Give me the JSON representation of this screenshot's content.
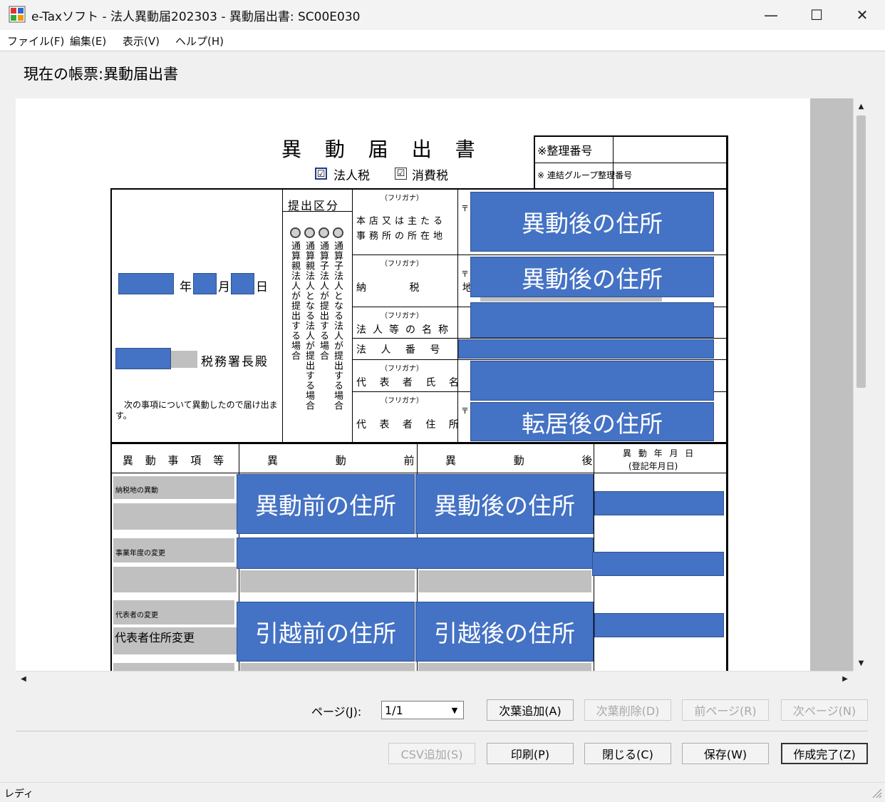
{
  "window": {
    "title": "e-Taxソフト - 法人異動届202303 - 異動届出書: SC00E030"
  },
  "window_buttons": {
    "minimize": "—",
    "maximize": "☐",
    "close": "✕"
  },
  "menu": [
    "ファイル(F)",
    "編集(E)",
    "表示(V)",
    "ヘルプ(H)"
  ],
  "current_form": "現在の帳票:異動届出書",
  "form": {
    "title": "異 動 届 出 書",
    "tax_types": [
      "法人税",
      "消費税"
    ],
    "tax_check_mark": "☑",
    "ref_number_label": "※整理番号",
    "group_ref_label": "※ 連結グループ整理番号",
    "date_labels": [
      "年",
      "月",
      "日"
    ],
    "tax_office_suffix": "税務署長殿",
    "notice": "次の事項について異動したので届け出ます。",
    "submit_category": "提出区分",
    "submit_options": [
      "通算子法人となる法人が提出する場合",
      "通算子法人が提出する場合",
      "通算親法人となる法人が提出する場合",
      "通算親法人が提出する場合"
    ],
    "furigana": "（フリガナ）",
    "postal_mark": "〒",
    "fields": {
      "head_office": "本店又は主たる事務所の所在地",
      "tax_place": "納 税 地",
      "corp_name": "法人等の名称",
      "corp_number": "法 人 番 号",
      "rep_name": "代 表 者 氏 名",
      "rep_address": "代 表 者 住 所"
    },
    "overlays": {
      "head_office": "異動後の住所",
      "tax_place": "異動後の住所",
      "rep_address": "転居後の住所"
    },
    "table_headers": {
      "item": "異 動 事 項 等",
      "before": "異 動 前",
      "after": "異 動 後",
      "date_line1": "異 動 年 月 日",
      "date_line2": "(登記年月日)"
    },
    "rows": [
      {
        "item": "納税地の異動",
        "before": "異動前の住所",
        "after": "異動後の住所"
      },
      {
        "item": "事業年度の変更",
        "before": "",
        "after": ""
      },
      {
        "item": "代表者の変更",
        "sub": "代表者住所変更",
        "before": "引越前の住所",
        "after": "引越後の住所"
      }
    ]
  },
  "page_selector": {
    "label": "ページ(J):",
    "value": "1/1"
  },
  "buttons_row1": [
    {
      "label": "次葉追加(A)",
      "enabled": true
    },
    {
      "label": "次葉削除(D)",
      "enabled": false
    },
    {
      "label": "前ページ(R)",
      "enabled": false
    },
    {
      "label": "次ページ(N)",
      "enabled": false
    }
  ],
  "buttons_row2": [
    {
      "label": "CSV追加(S)",
      "enabled": false
    },
    {
      "label": "印刷(P)",
      "enabled": true
    },
    {
      "label": "閉じる(C)",
      "enabled": true
    },
    {
      "label": "保存(W)",
      "enabled": true
    },
    {
      "label": "作成完了(Z)",
      "enabled": true
    }
  ],
  "status": "レディ",
  "colors": {
    "overlay": "#4472c4",
    "gray_field": "#c0c0c0"
  }
}
